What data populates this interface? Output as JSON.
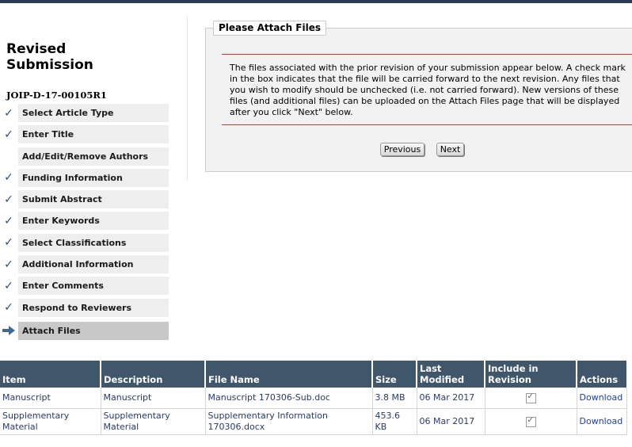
{
  "page": {
    "heading_line1": "Revised",
    "heading_line2": "Submission",
    "manuscript_id": "JOIP-D-17-00105R1"
  },
  "steps": [
    {
      "label": "Select Article Type",
      "status": "done"
    },
    {
      "label": "Enter Title",
      "status": "done"
    },
    {
      "label": "Add/Edit/Remove Authors",
      "status": "none"
    },
    {
      "label": "Funding Information",
      "status": "done"
    },
    {
      "label": "Submit Abstract",
      "status": "done"
    },
    {
      "label": "Enter Keywords",
      "status": "done"
    },
    {
      "label": "Select Classifications",
      "status": "done"
    },
    {
      "label": "Additional Information",
      "status": "done"
    },
    {
      "label": "Enter Comments",
      "status": "done"
    },
    {
      "label": "Respond to Reviewers",
      "status": "done"
    },
    {
      "label": "Attach Files",
      "status": "current"
    }
  ],
  "icons": {
    "done": "checkmark-icon",
    "current": "arrow-right-icon"
  },
  "colors": {
    "header_bg": "#40566b",
    "rule": "#c0392b",
    "link": "#1a3fb0",
    "current_step_bg": "#c8c8c8"
  },
  "panel": {
    "title": "Please Attach Files",
    "message": "The files associated with the prior revision of your submission appear below. A check mark in the box indicates that the file will be carried forward to the next revision. Any files that you wish to modify should be unchecked (i.e. not carried forward). New versions of these files (and additional files) can be uploaded on the Attach Files page that will be displayed after you click \"Next\" below.",
    "previous_label": "Previous",
    "next_label": "Next"
  },
  "table": {
    "headers": {
      "item": "Item",
      "description": "Description",
      "file_name": "File Name",
      "size": "Size",
      "last_modified": "Last Modified",
      "include": "Include in Revision",
      "actions": "Actions"
    },
    "rows": [
      {
        "item": "Manuscript",
        "description": "Manuscript",
        "file_name": "Manuscript 170306-Sub.doc",
        "size": "3.8 MB",
        "last_modified": "06 Mar 2017",
        "include": true,
        "action": "Download"
      },
      {
        "item": "Supplementary Material",
        "description": "Supplementary Material",
        "file_name": "Supplementary Information 170306.docx",
        "size": "453.6 KB",
        "last_modified": "06 Mar 2017",
        "include": true,
        "action": "Download"
      }
    ]
  }
}
